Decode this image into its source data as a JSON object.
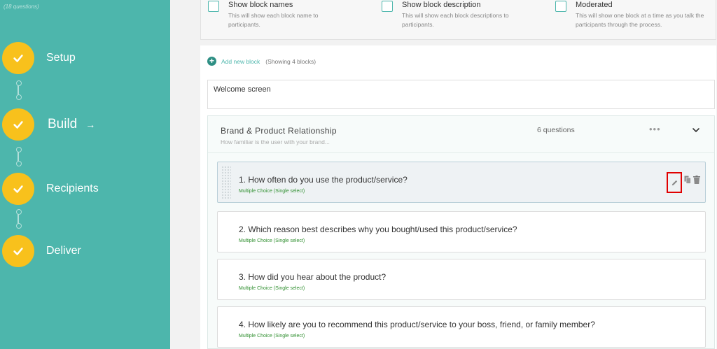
{
  "sidebar": {
    "topnote": "(18 questions)",
    "steps": [
      {
        "label": "Setup"
      },
      {
        "label": "Build",
        "arrow": "→"
      },
      {
        "label": "Recipients"
      },
      {
        "label": "Deliver"
      }
    ]
  },
  "options": [
    {
      "title": "Show block names",
      "desc": "This will show each block name to participants."
    },
    {
      "title": "Show block description",
      "desc": "This will show each block descriptions to participants."
    },
    {
      "title": "Moderated",
      "desc": "This will show one block at a time as you talk the participants through the process."
    }
  ],
  "add_block": {
    "plus": "+",
    "label": "Add new block",
    "showing": "(Showing 4 blocks)"
  },
  "welcome": "Welcome screen",
  "block": {
    "title": "Brand & Product Relationship",
    "desc": "How familiar is the user with your brand...",
    "count": "6 questions",
    "menu": "•••",
    "questions": [
      {
        "text": "1. How often do you use the product/service?",
        "type": "Multiple Choice (Single select)"
      },
      {
        "text": "2. Which reason best describes why you bought/used this product/service?",
        "type": "Multiple Choice (Single select)"
      },
      {
        "text": "3. How did you hear about the product?",
        "type": "Multiple Choice (Single select)"
      },
      {
        "text": "4. How likely are you to recommend this product/service to your boss, friend, or family member?",
        "type": "Multiple Choice (Single select)"
      }
    ]
  },
  "colors": {
    "sidebar": "#4db6ac",
    "step_circle": "#f8c11c",
    "highlight": "#e00000"
  }
}
